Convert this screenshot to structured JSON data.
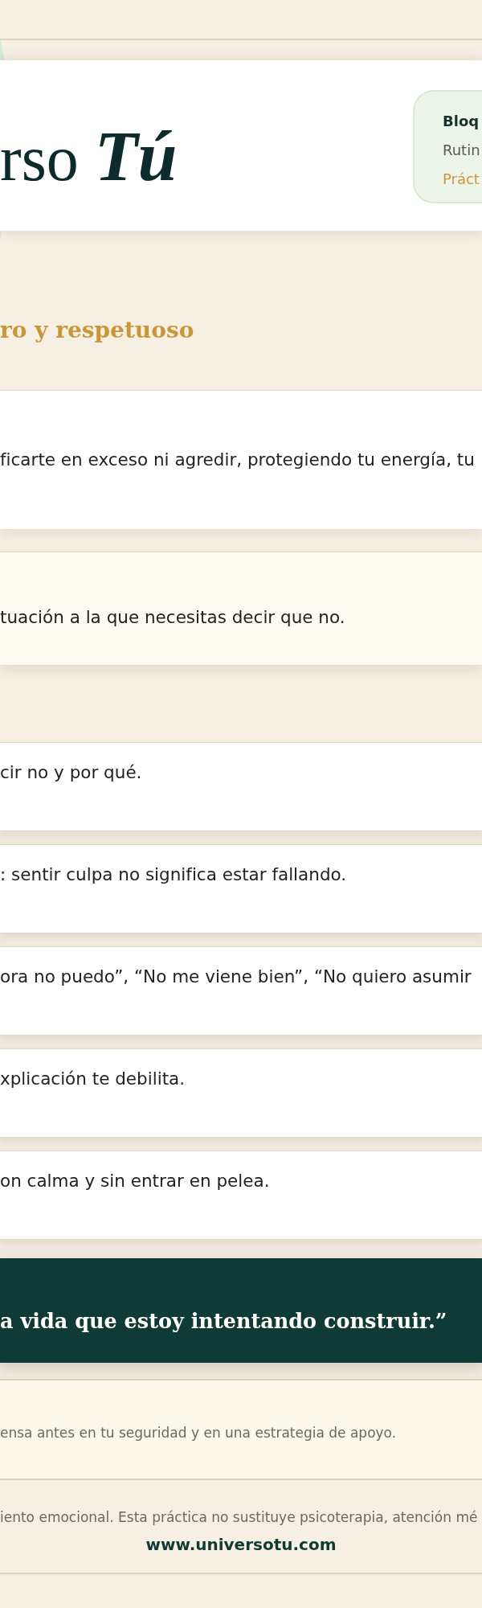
{
  "header": {
    "logo": {
      "text": "rso",
      "script": "Tú"
    },
    "panel": {
      "title": "Bloq",
      "subtitle": "Rutin",
      "tag": "Práct"
    }
  },
  "section_title": "ro y respetuoso",
  "intro": "ficarte en exceso ni agredir, protegiendo tu energía, tu",
  "exercise": "tuación a la que necesitas decir que no.",
  "steps": [
    {
      "text": "cir no y por qué."
    },
    {
      "text": ": sentir culpa no significa estar fallando."
    },
    {
      "text": "ora no puedo”, “No me viene bien”, “No quiero asumir"
    },
    {
      "text": "xplicación te debilita."
    },
    {
      "text": "on calma y sin entrar en pelea."
    }
  ],
  "quote": "a vida que estoy intentando construir.”",
  "note": "ensa antes en tu seguridad y en una estrategia de apoyo.",
  "footer": {
    "disclaimer": "iento emocional. Esta práctica no sustituye psicoterapia, atención mé",
    "url": "www.universotu.com"
  }
}
